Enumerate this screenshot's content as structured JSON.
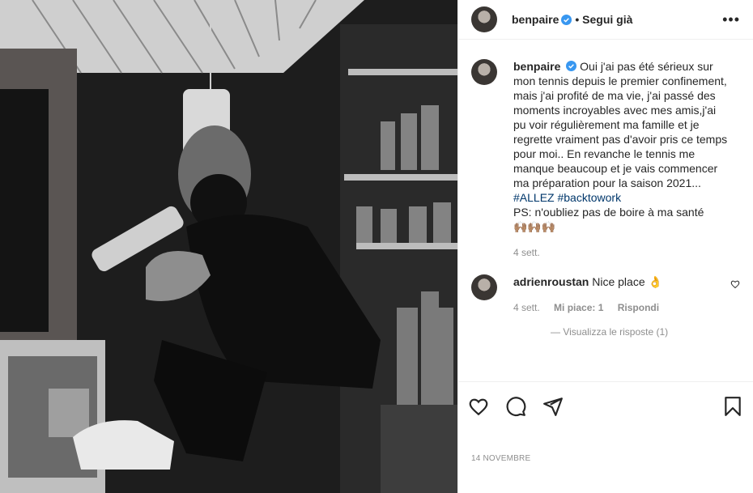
{
  "header": {
    "username": "benpaire",
    "follow_status": "• Segui già",
    "more_label": "•••"
  },
  "caption": {
    "username": "benpaire",
    "text": "Oui j'ai pas été sérieux sur mon tennis depuis le premier confinement, mais j'ai profité de ma vie, j'ai passé des moments incroyables avec mes amis,j'ai pu voir régulièrement ma famille et je regrette vraiment pas d'avoir pris ce temps pour moi.. En revanche le tennis me manque beaucoup et je vais commencer ma préparation pour la saison 2021...",
    "hashtags": [
      "#ALLEZ",
      "#backtowork"
    ],
    "ps": "PS: n'oubliez pas de boire à ma santé",
    "emoji": "🙌🏽🙌🏽🙌🏽",
    "time": "4 sett."
  },
  "comments": [
    {
      "username": "adrienroustan",
      "text": "Nice place 👌",
      "time": "4 sett.",
      "likes": "Mi piace: 1",
      "reply": "Rispondi"
    }
  ],
  "more_replies": "— Visualizza le risposte (1)",
  "footer": {
    "date": "14 NOVEMBRE"
  },
  "icons": [
    "verified-badge-icon",
    "more-icon",
    "heart-icon",
    "comment-icon",
    "share-icon",
    "save-icon"
  ],
  "colors": {
    "link": "#00376b",
    "verified": "#3897f0",
    "muted": "#8e8e8e"
  }
}
